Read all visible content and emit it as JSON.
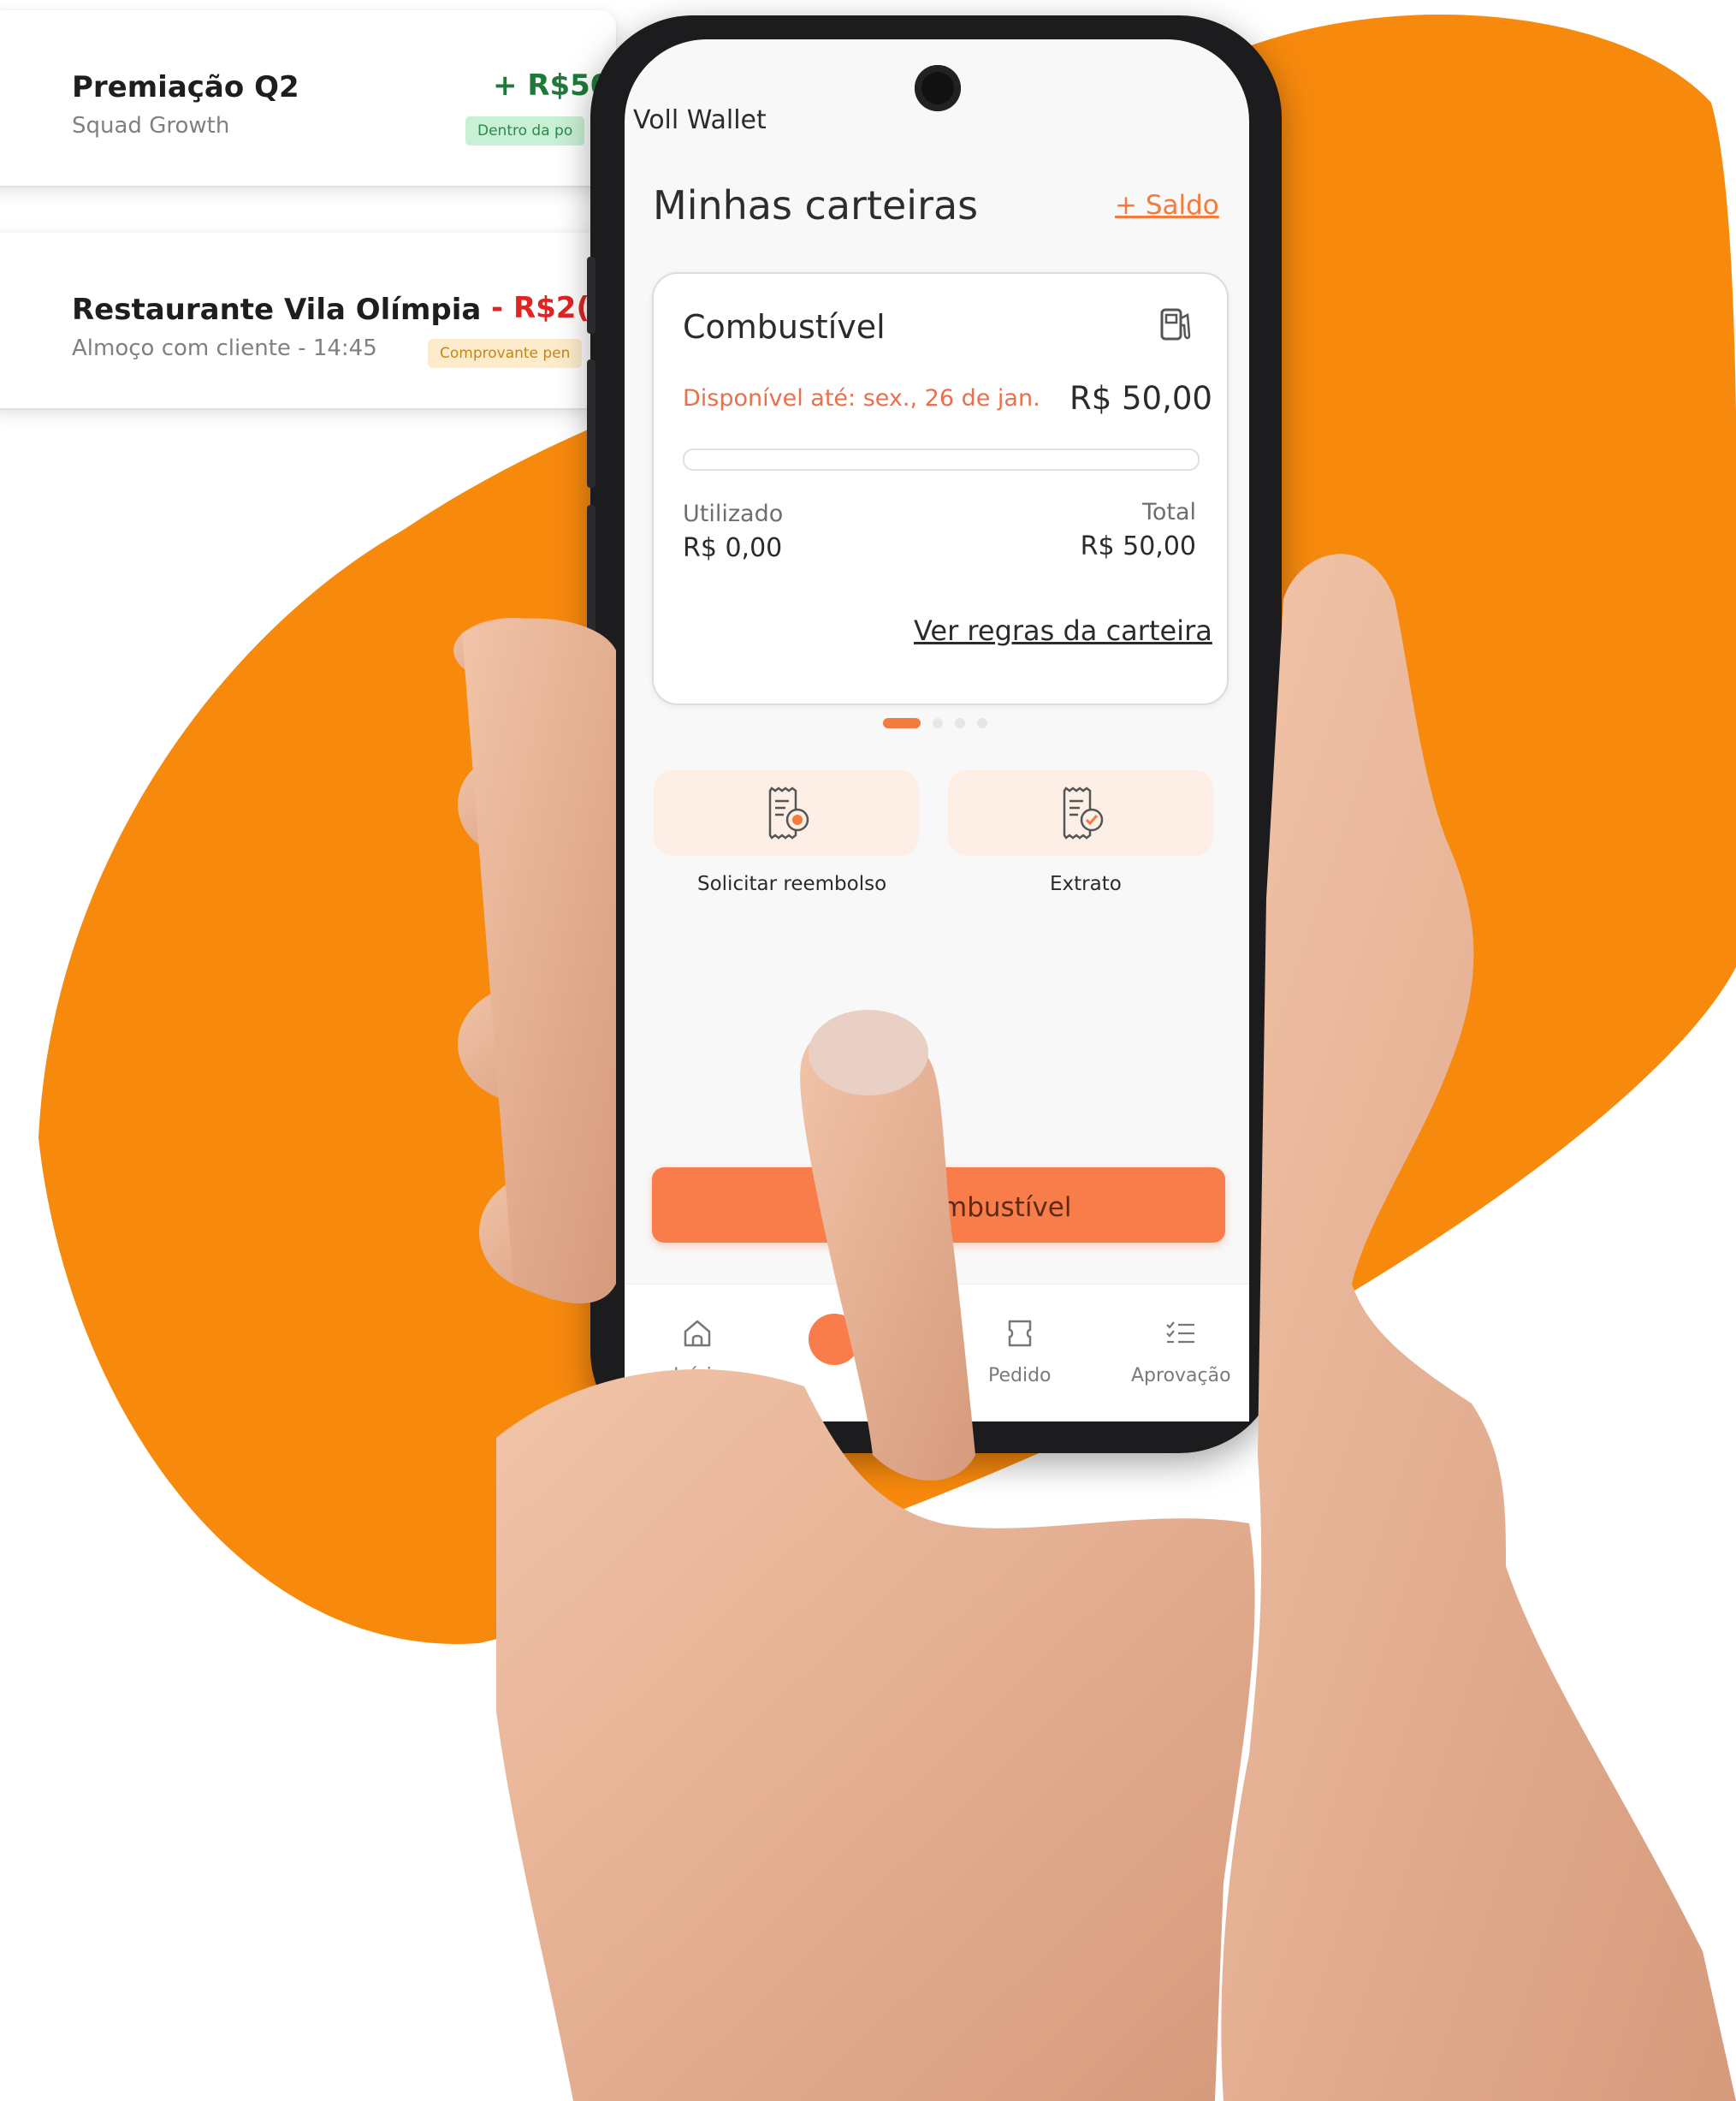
{
  "colors": {
    "brand_orange": "#f7890d",
    "accent": "#f27b3d",
    "cta": "#f97d4a",
    "positive": "#1f7a3a",
    "negative": "#e02424"
  },
  "transactions": [
    {
      "title": "Premiação Q2",
      "subtitle": "Squad Growth",
      "amount": "+ R$50",
      "badge": "Dentro da po",
      "icon": "receipt-icon"
    },
    {
      "title": "Restaurante Vila Olímpia",
      "subtitle": "Almoço com cliente - 14:45",
      "amount": "- R$2(",
      "badge": "Comprovante pen",
      "icon": "receipt-icon"
    }
  ],
  "app": {
    "title": "Voll Wallet",
    "page_title": "Minhas carteiras",
    "add_balance": "+ Saldo"
  },
  "wallet": {
    "name": "Combustível",
    "icon": "fuel-pump-icon",
    "availability": "Disponível até: sex., 26 de jan.",
    "balance": "R$ 50,00",
    "used_label": "Utilizado",
    "used_value": "R$ 0,00",
    "total_label": "Total",
    "total_value": "R$ 50,00",
    "used_fraction": 0,
    "rules_link": "Ver regras da carteira",
    "carousel_index": 0,
    "carousel_count": 4
  },
  "actions": [
    {
      "label": "Solicitar reembolso",
      "icon": "receipt-dollar-icon"
    },
    {
      "label": "Extrato",
      "icon": "receipt-check-icon"
    }
  ],
  "cta_label": "mbustível",
  "nav": [
    {
      "label": "Início",
      "icon": "home-icon"
    },
    {
      "label": "Pedido",
      "icon": "ticket-icon"
    },
    {
      "label": "Aprovação",
      "icon": "checklist-icon"
    }
  ]
}
